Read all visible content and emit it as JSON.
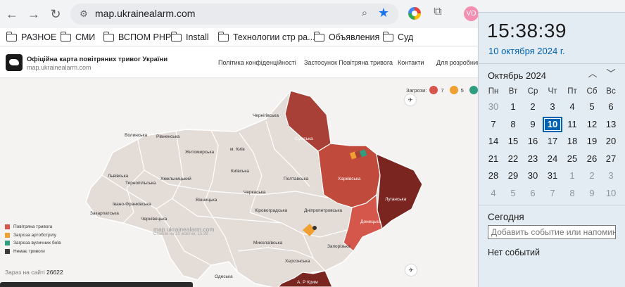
{
  "browser": {
    "url": "map.ukrainealarm.com",
    "profile_initials": "VD",
    "icons": [
      "back-arrow-icon",
      "forward-arrow-icon",
      "reload-icon",
      "site-info-icon",
      "zoom-icon",
      "star-icon",
      "color-extension-icon",
      "puzzle-icon"
    ]
  },
  "bookmarks": [
    "РАЗНОЕ",
    "СМИ",
    "ВСПОМ PHP",
    "Install",
    "Технологии стр ра...",
    "Объявления",
    "Суд"
  ],
  "site": {
    "title": "Офіційна карта повітряних тривог України",
    "url": "map.ukrainealarm.com",
    "nav": [
      "Політика конфіденційності",
      "Застосунок Повітряна тривога",
      "Контакти",
      "Для розробникі"
    ],
    "threats": {
      "label": "Загрози:",
      "counts": [
        "7",
        "5"
      ]
    },
    "legend": [
      {
        "label": "Повітряна тривога",
        "color": "#d5574b"
      },
      {
        "label": "Загроза артобстрілу",
        "color": "#f0a030"
      },
      {
        "label": "Загроза вуличних боїв",
        "color": "#2f9e7e"
      },
      {
        "label": "Немає тривоги",
        "color": "#3c3c3c"
      }
    ],
    "watermark": "map.ukrainealarm.com",
    "watermark_sub": "Станом на 10 жовтня, 15:38",
    "online_label": "Зараз на сайті",
    "online_count": "26622",
    "map_labels": {
      "volyn": "Волинська",
      "rivne": "Рівненська",
      "zhytomyr": "Житомирська",
      "chernihiv": "Чернігівська",
      "sumy": "Сумська",
      "kyiv_city": "м. Київ",
      "kyiv": "Київська",
      "lviv": "Львівська",
      "khmelnytskyi": "Хмельницький",
      "ternopil": "Тернопільська",
      "vinnytsia": "Вінницька",
      "cherkasy": "Черкаська",
      "poltava": "Полтавська",
      "kharkiv": "Харківська",
      "luhansk": "Луганська",
      "ivano": "Івано-Франківська",
      "zakarpattia": "Закарпатська",
      "chernivtsi": "Чернівецька",
      "kirovohrad": "Кіровоградська",
      "dnipro": "Дніпропетровська",
      "donetsk": "Донецька",
      "mykolaiv": "Миколаївська",
      "zaporizhzhia": "Запорізька",
      "kherson": "Херсонська",
      "odesa": "Одеська",
      "crimea": "А. Р Крим"
    }
  },
  "calendar": {
    "time": "15:38:39",
    "date": "10 октября 2024 г.",
    "month": "Октябрь 2024",
    "weekdays": [
      "Пн",
      "Вт",
      "Ср",
      "Чт",
      "Пт",
      "Сб",
      "Вс"
    ],
    "weeks": [
      [
        "30",
        "1",
        "2",
        "3",
        "4",
        "5",
        "6"
      ],
      [
        "7",
        "8",
        "9",
        "10",
        "11",
        "12",
        "13"
      ],
      [
        "14",
        "15",
        "16",
        "17",
        "18",
        "19",
        "20"
      ],
      [
        "21",
        "22",
        "23",
        "24",
        "25",
        "26",
        "27"
      ],
      [
        "28",
        "29",
        "30",
        "31",
        "1",
        "2",
        "3"
      ],
      [
        "4",
        "5",
        "6",
        "7",
        "8",
        "9",
        "10"
      ]
    ],
    "today_label": "Сегодня",
    "event_placeholder": "Добавить событие или напомина",
    "no_events": "Нет событий"
  }
}
